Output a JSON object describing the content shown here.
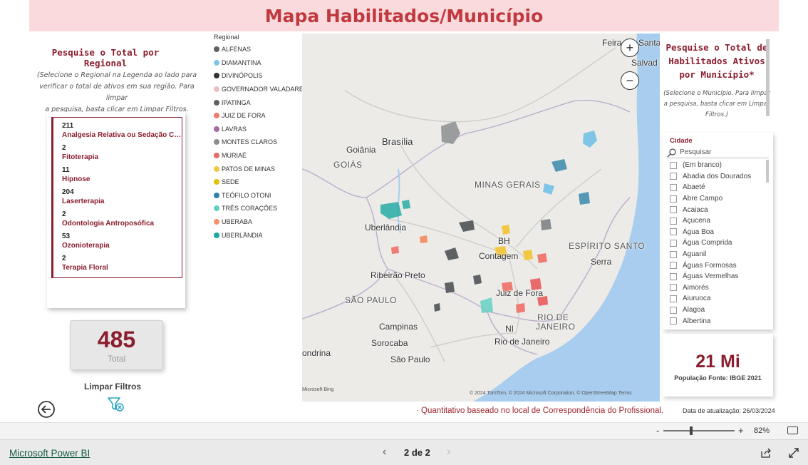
{
  "header": {
    "title": "Mapa Habilitados/Município"
  },
  "left_panel": {
    "title": "Pesquise o Total por Regional",
    "hint_lines": [
      "(Selecione o Regional na Legenda ao lado para",
      "verificar o total de ativos em sua região. Para limpar",
      "a pesquisa, basta clicar em Limpar Filtros."
    ],
    "therapies": [
      {
        "count": "211",
        "name": "Analgesia Relativa ou Sedação Co..."
      },
      {
        "count": "2",
        "name": "Fitoterapia"
      },
      {
        "count": "11",
        "name": "Hipnose"
      },
      {
        "count": "204",
        "name": "Laserterapia"
      },
      {
        "count": "2",
        "name": "Odontologia Antroposófica"
      },
      {
        "count": "53",
        "name": "Ozonioterapia"
      },
      {
        "count": "2",
        "name": "Terapia Floral"
      }
    ],
    "total_value": "485",
    "total_label": "Total",
    "clear_filters_label": "Limpar Filtros"
  },
  "legend": {
    "title": "Regional",
    "items": [
      {
        "label": "ALFENAS",
        "color": "#5f6264"
      },
      {
        "label": "DIAMANTINA",
        "color": "#7fc6e6"
      },
      {
        "label": "DIVINÓPOLIS",
        "color": "#2f3336"
      },
      {
        "label": "GOVERNADOR VALADARES",
        "color": "#e8bfc2"
      },
      {
        "label": "IPATINGA",
        "color": "#5d6166"
      },
      {
        "label": "JUIZ DE FORA",
        "color": "#f07b72"
      },
      {
        "label": "LAVRAS",
        "color": "#a86aa0"
      },
      {
        "label": "MONTES CLAROS",
        "color": "#8a8d8f"
      },
      {
        "label": "MURIAÉ",
        "color": "#e96a6a"
      },
      {
        "label": "PATOS DE MINAS",
        "color": "#f2c744"
      },
      {
        "label": "SEDE",
        "color": "#e0c200"
      },
      {
        "label": "TEÓFILO OTONI",
        "color": "#2f83a8"
      },
      {
        "label": "TRÊS CORAÇÕES",
        "color": "#5ecfc0"
      },
      {
        "label": "UBERABA",
        "color": "#f5926a"
      },
      {
        "label": "UBERLÂNDIA",
        "color": "#1aa9a0"
      }
    ]
  },
  "map": {
    "labels": {
      "feira": "Feira",
      "santana": "Santa",
      "salvador": "Salvad",
      "brasilia": "Brasília",
      "goiania": "Goiânia",
      "goias": "GOIÁS",
      "minas": "MINAS GERAIS",
      "uberlandia": "Uberlândia",
      "bh": "BH",
      "contagem": "Contagem",
      "espirito": "ESPÍRITO SANTO",
      "serra": "Serra",
      "ribeirao": "Ribeirão Preto",
      "saopaulo_state": "SÃO PAULO",
      "juiz": "Juiz de Fora",
      "rio_state_1": "RIO DE",
      "rio_state_2": "JANEIRO",
      "campinas": "Campinas",
      "ni": "NI",
      "rio_city": "Rio de Janeiro",
      "sorocaba": "Sorocaba",
      "londrina": "ondrina",
      "saopaulo_city": "São Paulo"
    },
    "attribution": "© 2024 TomTom, © 2024 Microsoft Corporation, © OpenStreetMap  Terms",
    "logo_text": "Microsoft Bing",
    "zoom_in": "+",
    "zoom_out": "−"
  },
  "right_panel": {
    "title": "Pesquise o Total de Habilitados Ativos por Município*",
    "hint": "(Selecione o Município. Para limpar a pesquisa, basta clicar em Limpar Filtros.)",
    "city_slicer_title": "Cidade",
    "search_placeholder": "Pesquisar",
    "cities": [
      "(Em branco)",
      "Abadia dos Dourados",
      "Abaeté",
      "Abre Campo",
      "Acaiaca",
      "Açucena",
      "Água Boa",
      "Água Comprida",
      "Aguanil",
      "Águas Formosas",
      "Águas Vermelhas",
      "Aimorés",
      "Aiuruoca",
      "Alagoa",
      "Albertina"
    ],
    "population_value": "21 Mi",
    "population_label": "População Fonte: IBGE 2021"
  },
  "footnote": "· Quantitativo baseado no local de Correspondência do Profissional.",
  "update_date": "Data de atualização: 26/03/2024",
  "zoom_bar": {
    "minus": "-",
    "plus": "+",
    "percent": "82%"
  },
  "footer": {
    "powerbi_link": "Microsoft Power BI",
    "page_indicator": "2 de 2",
    "prev": "‹",
    "next": "›"
  }
}
